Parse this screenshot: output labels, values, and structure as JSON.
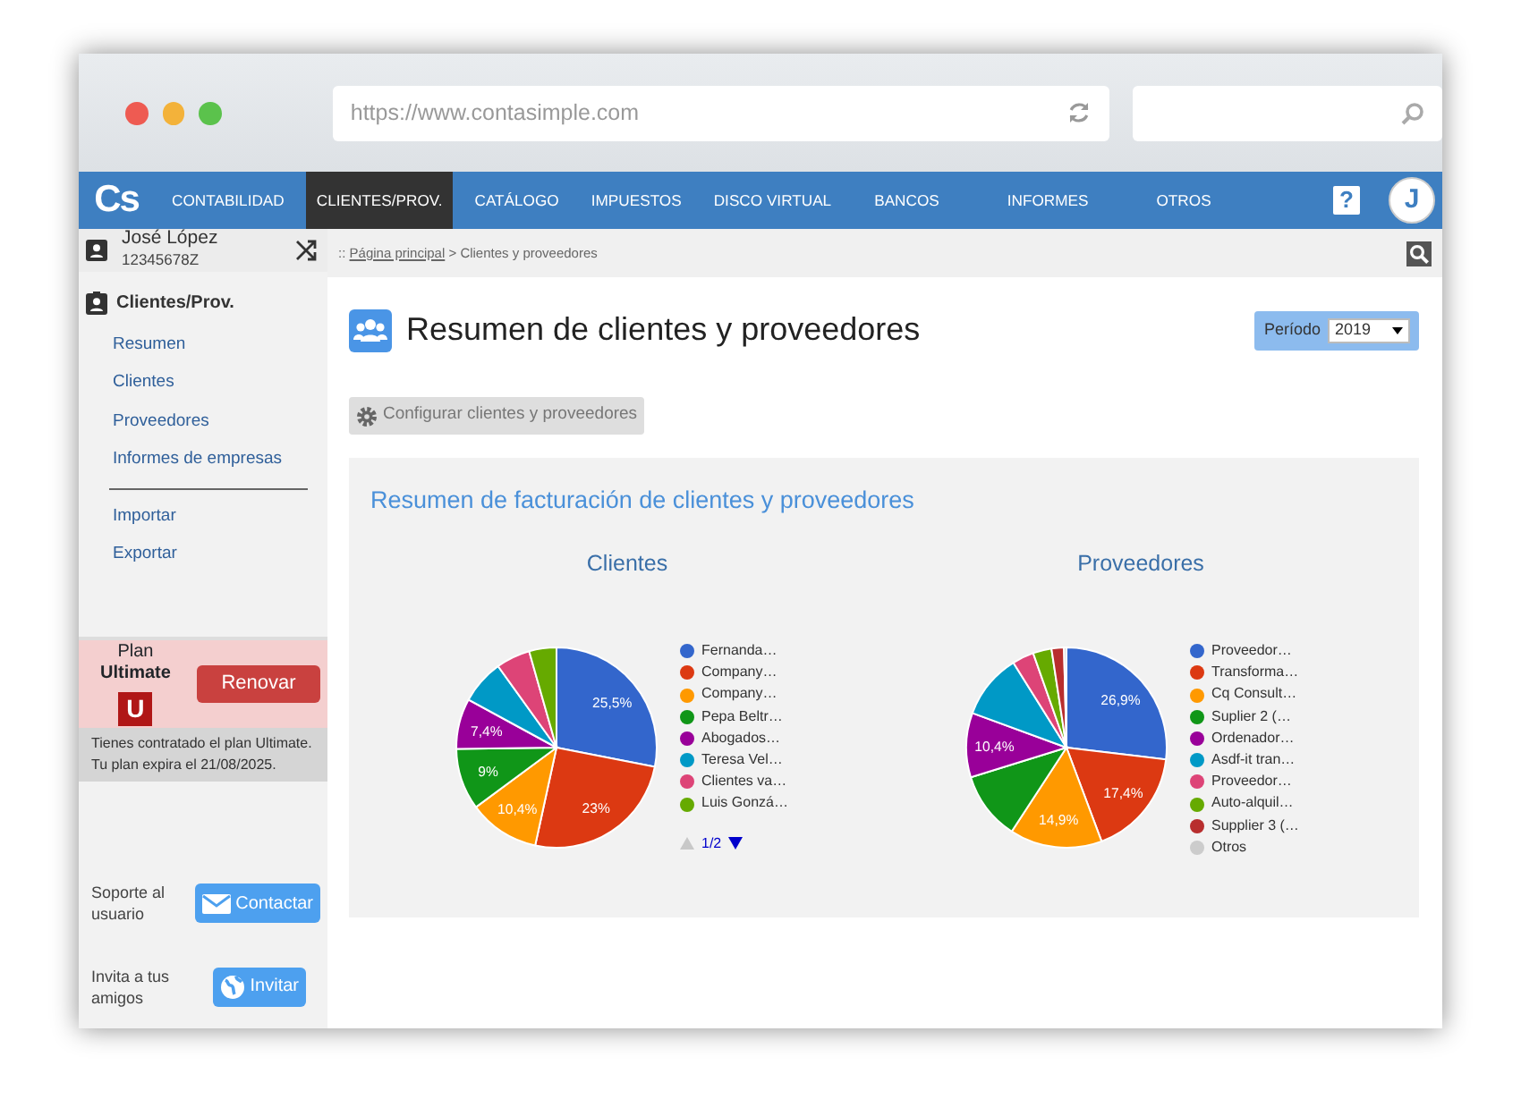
{
  "browser": {
    "url": "https://www.contasimple.com"
  },
  "navbar": {
    "logo": "Cs",
    "help": "?",
    "avatar": "J",
    "items": [
      {
        "label": "CONTABILIDAD",
        "selected": false
      },
      {
        "label": "CLIENTES/PROV.",
        "selected": true
      },
      {
        "label": "CATÁLOGO",
        "selected": false
      },
      {
        "label": "IMPUESTOS",
        "selected": false
      },
      {
        "label": "DISCO VIRTUAL",
        "selected": false
      },
      {
        "label": "BANCOS",
        "selected": false
      },
      {
        "label": "INFORMES",
        "selected": false
      },
      {
        "label": "OTROS",
        "selected": false
      }
    ]
  },
  "user": {
    "name": "José López",
    "id": "12345678Z"
  },
  "sidebar": {
    "section": "Clientes/Prov.",
    "items": [
      "Resumen",
      "Clientes",
      "Proveedores",
      "Informes de empresas"
    ],
    "secondary": [
      "Importar",
      "Exportar"
    ]
  },
  "plan": {
    "label": "Plan",
    "name": "Ultimate",
    "badge": "U",
    "button": "Renovar",
    "info": [
      "Tienes contratado el plan Ultimate.",
      "Tu plan expira el 21/08/2025."
    ]
  },
  "support": [
    {
      "label": "Soporte al usuario",
      "button": "Contactar",
      "kind": "mail"
    },
    {
      "label": "Invita a tus amigos",
      "button": "Invitar",
      "kind": "globe"
    }
  ],
  "breadcrumb": {
    "prefix": "::",
    "link": "Página principal",
    "rest": "> Clientes y proveedores"
  },
  "page": {
    "title": "Resumen de clientes y proveedores",
    "period_label": "Período",
    "period_value": "2019",
    "config_button": "Configurar clientes y proveedores"
  },
  "summary": {
    "title": "Resumen de facturación de clientes y proveedores",
    "charts": [
      {
        "chart_data": {
          "type": "pie",
          "title": "Clientes",
          "categories": [
            "Fernanda…",
            "Company…",
            "Company…",
            "Pepa Beltr…",
            "Abogados…",
            "Teresa Vel…",
            "Clientes va…",
            "Luis Gonzá…"
          ],
          "legend": "right",
          "values": [
            25.5,
            23,
            10.4,
            9,
            7.4,
            6.5,
            5,
            4
          ],
          "colors": [
            "#3366cc",
            "#dc3912",
            "#ff9900",
            "#109618",
            "#990099",
            "#0099c6",
            "#dd4477",
            "#66aa00"
          ],
          "value_labels": [
            "25,5%",
            "23%",
            "10,4%",
            "9%",
            "7,4%",
            null,
            null,
            null
          ]
        },
        "pager": {
          "text": "1/2",
          "prev_disabled": true,
          "next_disabled": false
        }
      },
      {
        "chart_data": {
          "type": "pie",
          "title": "Proveedores",
          "categories": [
            "Proveedor…",
            "Transforma…",
            "Cq Consult…",
            "Suplier 2 (…",
            "Ordenador…",
            "Asdf-it tran…",
            "Proveedor…",
            "Auto-alquil…",
            "Supplier 3 (…",
            "Otros"
          ],
          "legend": "right",
          "values": [
            26.9,
            17.4,
            14.9,
            11,
            10.4,
            10.5,
            3.5,
            3,
            2,
            0.4
          ],
          "colors": [
            "#3366cc",
            "#dc3912",
            "#ff9900",
            "#109618",
            "#990099",
            "#0099c6",
            "#dd4477",
            "#66aa00",
            "#b82e2e",
            "#cccccc"
          ],
          "value_labels": [
            "26,9%",
            "17,4%",
            "14,9%",
            null,
            "10,4%",
            null,
            null,
            null,
            null,
            null
          ]
        }
      }
    ]
  }
}
